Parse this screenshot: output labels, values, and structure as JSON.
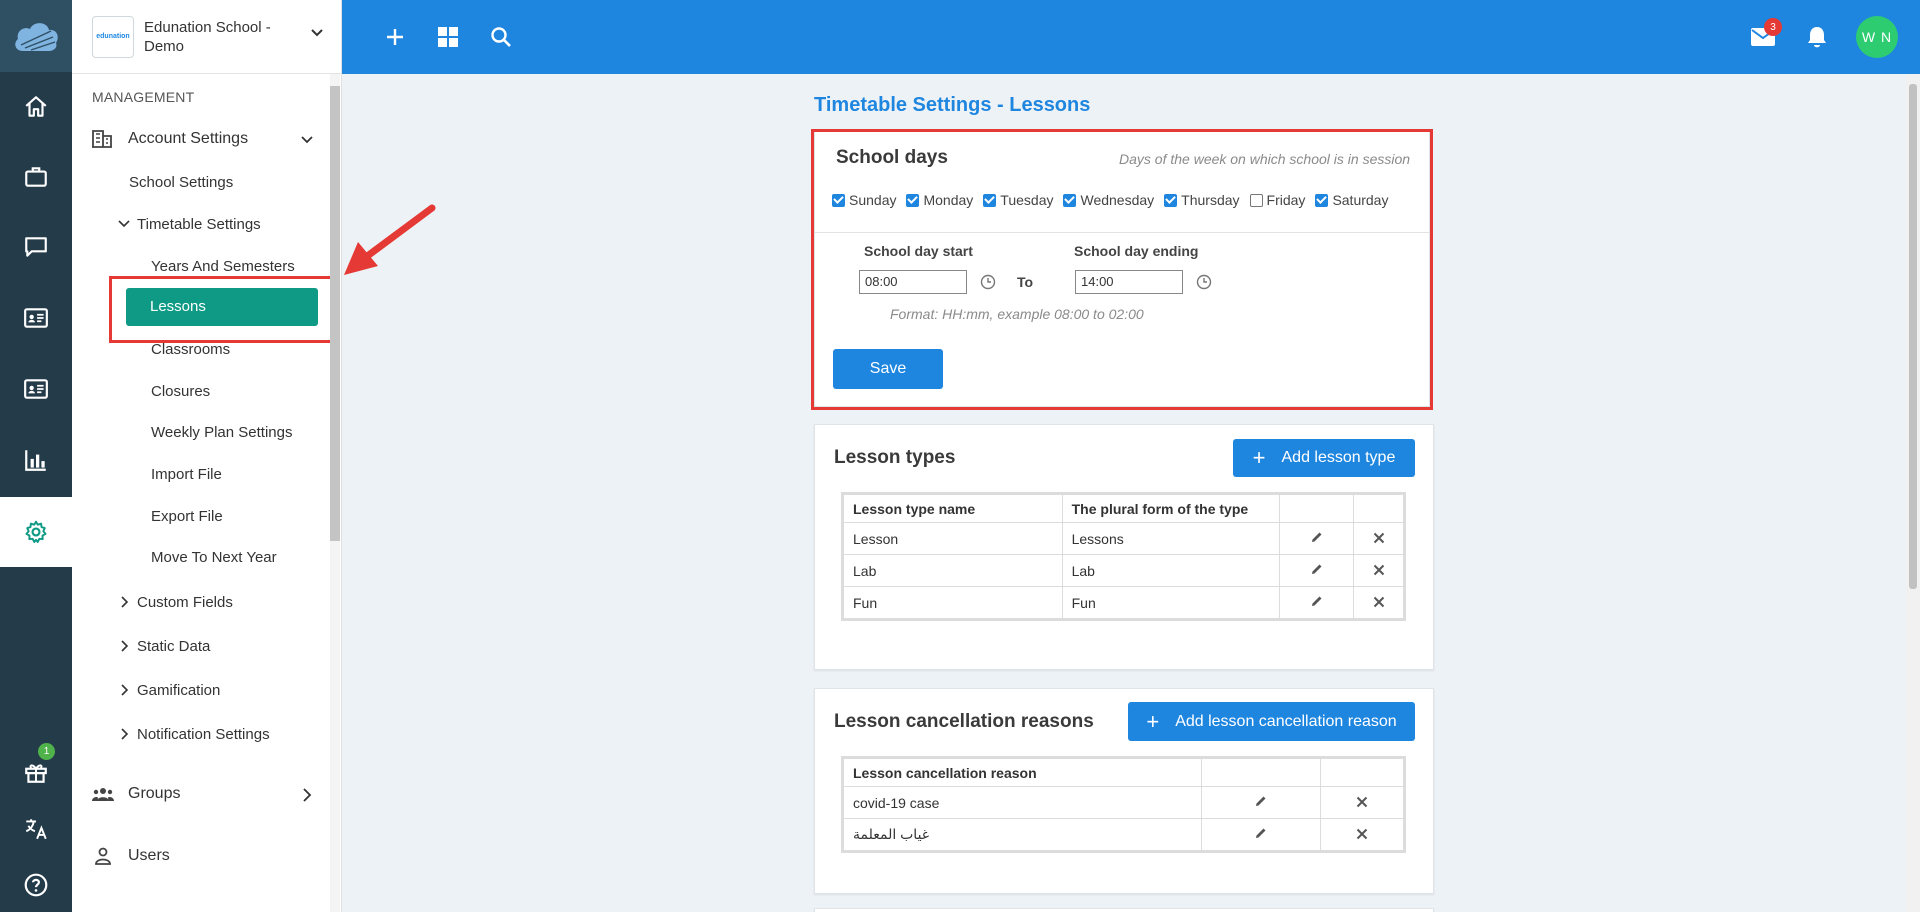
{
  "app": {
    "school_name": "Edunation School - Demo",
    "logo_text": "edunation"
  },
  "rail": {
    "icons": [
      "home-icon",
      "briefcase-icon",
      "chat-icon",
      "id-card-icon",
      "id-card-icon",
      "bar-chart-icon",
      "gear-icon",
      "gift-icon",
      "translate-icon",
      "help-icon"
    ],
    "gift_badge": "1"
  },
  "sidebar": {
    "section": "MANAGEMENT",
    "account_settings": "Account Settings",
    "school_settings": "School Settings",
    "timetable_settings": "Timetable Settings",
    "timetable_children": [
      "Years And Semesters",
      "Lessons",
      "Classrooms",
      "Closures",
      "Weekly Plan Settings",
      "Import File",
      "Export File",
      "Move To Next Year"
    ],
    "collapsed": [
      "Custom Fields",
      "Static Data",
      "Gamification",
      "Notification Settings"
    ],
    "groups": "Groups",
    "users": "Users"
  },
  "topbar": {
    "mail_badge": "3",
    "avatar_initials": "W N"
  },
  "page": {
    "title": "Timetable Settings - Lessons",
    "school_days": {
      "title": "School days",
      "hint": "Days of the week on which school is in session",
      "days": [
        {
          "label": "Sunday",
          "checked": true
        },
        {
          "label": "Monday",
          "checked": true
        },
        {
          "label": "Tuesday",
          "checked": true
        },
        {
          "label": "Wednesday",
          "checked": true
        },
        {
          "label": "Thursday",
          "checked": true
        },
        {
          "label": "Friday",
          "checked": false
        },
        {
          "label": "Saturday",
          "checked": true
        }
      ],
      "start_label": "School day start",
      "start_value": "08:00",
      "to_label": "To",
      "end_label": "School day ending",
      "end_value": "14:00",
      "format_hint": "Format: HH:mm, example 08:00 to 02:00",
      "save_label": "Save"
    },
    "lesson_types": {
      "title": "Lesson types",
      "add_label": "Add lesson type",
      "headers": [
        "Lesson type name",
        "The plural form of the type"
      ],
      "rows": [
        {
          "name": "Lesson",
          "plural": "Lessons"
        },
        {
          "name": "Lab",
          "plural": "Lab"
        },
        {
          "name": "Fun",
          "plural": "Fun"
        }
      ]
    },
    "cancellation": {
      "title": "Lesson cancellation reasons",
      "add_label": "Add lesson cancellation reason",
      "header": "Lesson cancellation reason",
      "rows": [
        "covid-19 case",
        "غياب المعلمة"
      ]
    }
  }
}
